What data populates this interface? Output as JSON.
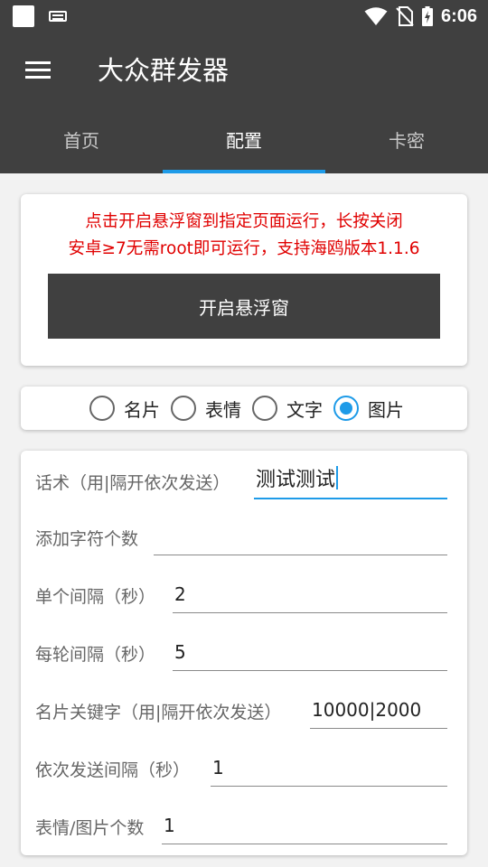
{
  "status_bar": {
    "time": "6:06"
  },
  "toolbar": {
    "title": "大众群发器",
    "menu_icon": "menu-icon"
  },
  "tabs": [
    {
      "label": "首页",
      "active": false
    },
    {
      "label": "配置",
      "active": true
    },
    {
      "label": "卡密",
      "active": false
    }
  ],
  "float_card": {
    "notice_line1": "点击开启悬浮窗到指定页面运行，长按关闭",
    "notice_line2": "安卓≥7无需root即可运行，支持海鸥版本1.1.6",
    "notice_color": "#e00000",
    "button_label": "开启悬浮窗"
  },
  "send_type": {
    "options": [
      {
        "label": "名片",
        "checked": false
      },
      {
        "label": "表情",
        "checked": false
      },
      {
        "label": "文字",
        "checked": false
      },
      {
        "label": "图片",
        "checked": true
      }
    ]
  },
  "form": {
    "fields": [
      {
        "label": "话术（用|隔开依次发送）",
        "value": "测试测试",
        "focused": true
      },
      {
        "label": "添加字符个数",
        "value": ""
      },
      {
        "label": "单个间隔（秒）",
        "value": "2"
      },
      {
        "label": "每轮间隔（秒）",
        "value": "5"
      },
      {
        "label": "名片关键字（用|隔开依次发送）",
        "value": "10000|2000"
      },
      {
        "label": "依次发送间隔（秒）",
        "value": "1"
      },
      {
        "label": "表情/图片个数",
        "value": "1"
      }
    ]
  },
  "colors": {
    "bar": "#404040",
    "accent": "#1e9be8",
    "background": "#f2f2f2"
  }
}
